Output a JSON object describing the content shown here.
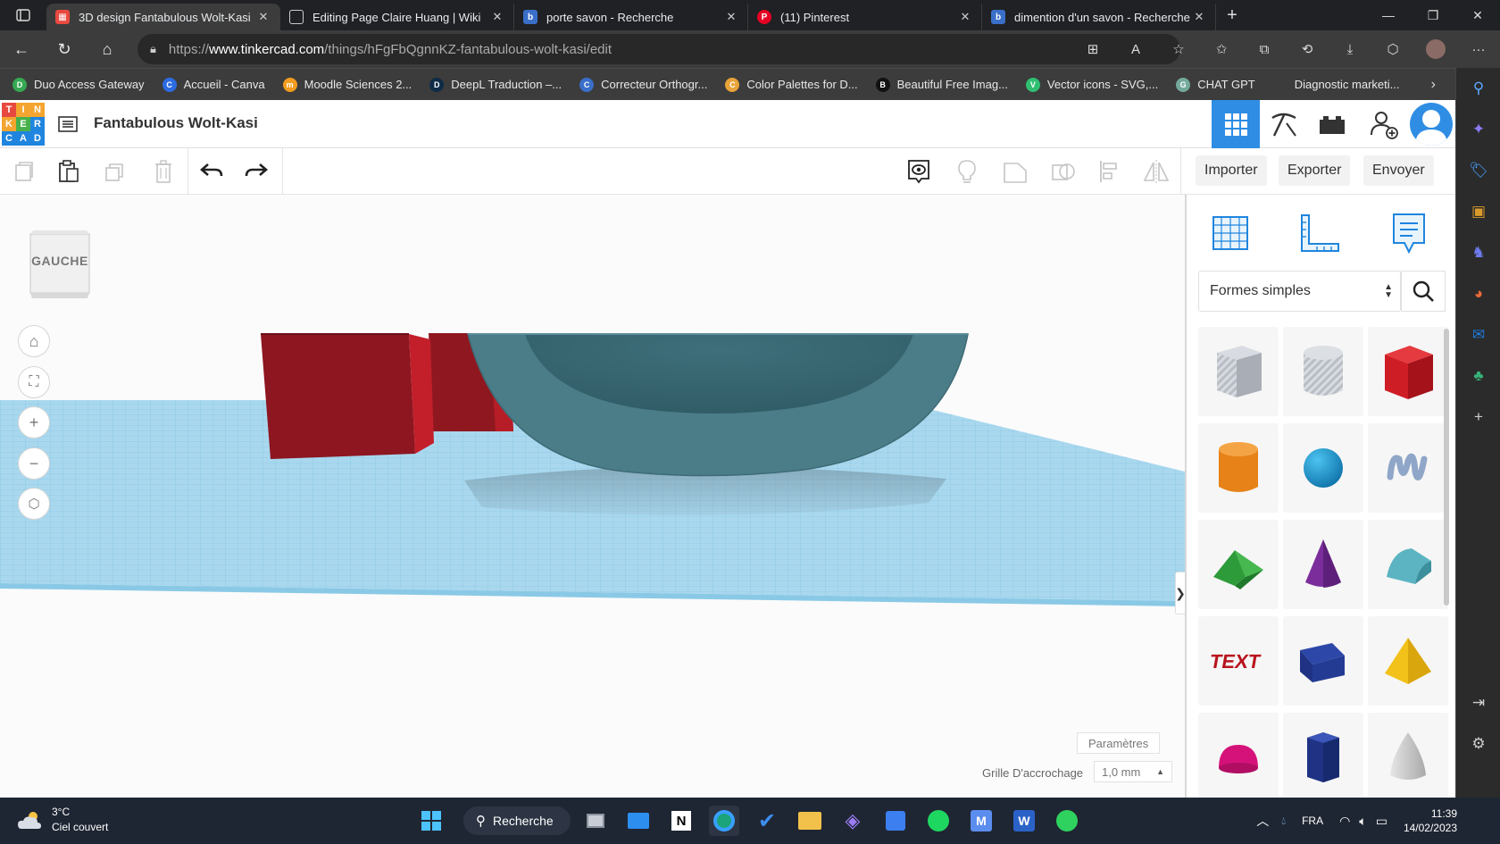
{
  "browser": {
    "tabs": [
      {
        "label": "3D design Fantabulous Wolt-Kasi",
        "icon": "tinkercad-favicon",
        "active": true
      },
      {
        "label": "Editing Page Claire Huang | Wiki",
        "icon": "page-favicon",
        "active": false
      },
      {
        "label": "porte savon - Recherche",
        "icon": "bing-favicon",
        "active": false
      },
      {
        "label": "(11) Pinterest",
        "icon": "pinterest-favicon",
        "active": false
      },
      {
        "label": "dimention d'un savon - Recherche",
        "icon": "bing-favicon",
        "active": false
      }
    ],
    "url_prefix": "https://",
    "url_host": "www.tinkercad.com",
    "url_path": "/things/hFgFbQgnnKZ-fantabulous-wolt-kasi/edit",
    "bookmarks": [
      {
        "label": "Duo Access Gateway",
        "color": "#36a852",
        "glyph": "D"
      },
      {
        "label": "Accueil - Canva",
        "color": "#2d6be3",
        "glyph": "C"
      },
      {
        "label": "Moodle Sciences 2...",
        "color": "#f29c1f",
        "glyph": "m"
      },
      {
        "label": "DeepL Traduction –...",
        "color": "#0f2b46",
        "glyph": "D"
      },
      {
        "label": "Correcteur Orthogr...",
        "color": "#3a6fc9",
        "glyph": "C"
      },
      {
        "label": "Color Palettes for D...",
        "color": "#e8a33a",
        "glyph": "C"
      },
      {
        "label": "Beautiful Free Imag...",
        "color": "#111111",
        "glyph": "B"
      },
      {
        "label": "Vector icons - SVG,...",
        "color": "#2fbf71",
        "glyph": "V"
      },
      {
        "label": "CHAT GPT",
        "color": "#74aa9c",
        "glyph": "G"
      },
      {
        "label": "Diagnostic marketi...",
        "color": "#3c3c3c",
        "glyph": ""
      }
    ]
  },
  "app": {
    "logo_letters": [
      "T",
      "I",
      "N",
      "K",
      "E",
      "R",
      "C",
      "A",
      "D"
    ],
    "design_title": "Fantabulous Wolt-Kasi",
    "import_label": "Importer",
    "export_label": "Exporter",
    "send_label": "Envoyer",
    "viewcube_label": "GAUCHE",
    "params_label": "Paramètres",
    "snap_label": "Grille D'accrochage",
    "snap_value": "1,0 mm",
    "library_select": "Formes simples",
    "shapes": [
      "box-striped",
      "cylinder-striped",
      "box-red",
      "cylinder-orange",
      "sphere-blue",
      "scribble",
      "roof-green",
      "cone-purple",
      "round-roof-teal",
      "text-red",
      "prism-navy",
      "pyramid-yellow",
      "half-sphere-magenta",
      "polygon-navy",
      "paraboloid-grey"
    ],
    "text_shape_label": "TEXT"
  },
  "taskbar": {
    "weather_temp": "3°C",
    "weather_desc": "Ciel couvert",
    "search_label": "Recherche",
    "lang": "FRA",
    "time": "11:39",
    "date": "14/02/2023"
  }
}
